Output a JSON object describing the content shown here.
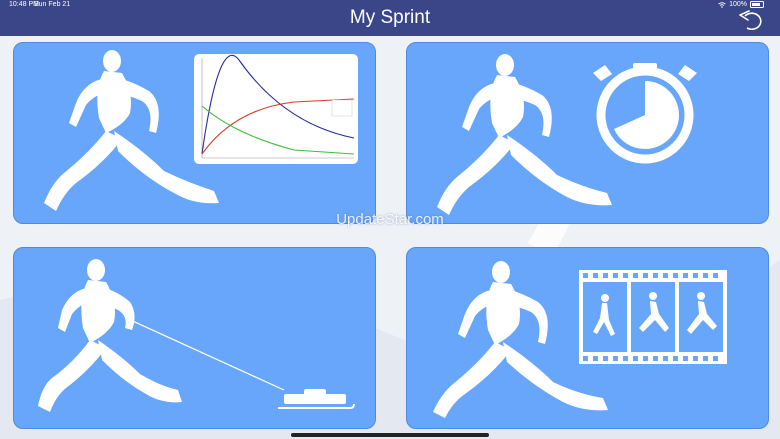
{
  "status": {
    "time": "10:48 PM",
    "date": "Sun Feb 21",
    "battery": "100%"
  },
  "header": {
    "title": "My Sprint"
  },
  "watermark": "UpdateStar.com",
  "icons": {
    "back": "back-arrow-icon",
    "card1": "runner-with-chart-icon",
    "card2": "runner-with-stopwatch-icon",
    "card3": "runner-with-sled-icon",
    "card4": "runner-with-filmstrip-icon"
  },
  "colors": {
    "navbar": "#3a4687",
    "card": "#67a6fa",
    "chart_blue": "#2b2f9c",
    "chart_red": "#d33a2c",
    "chart_green": "#3cbf3c"
  }
}
